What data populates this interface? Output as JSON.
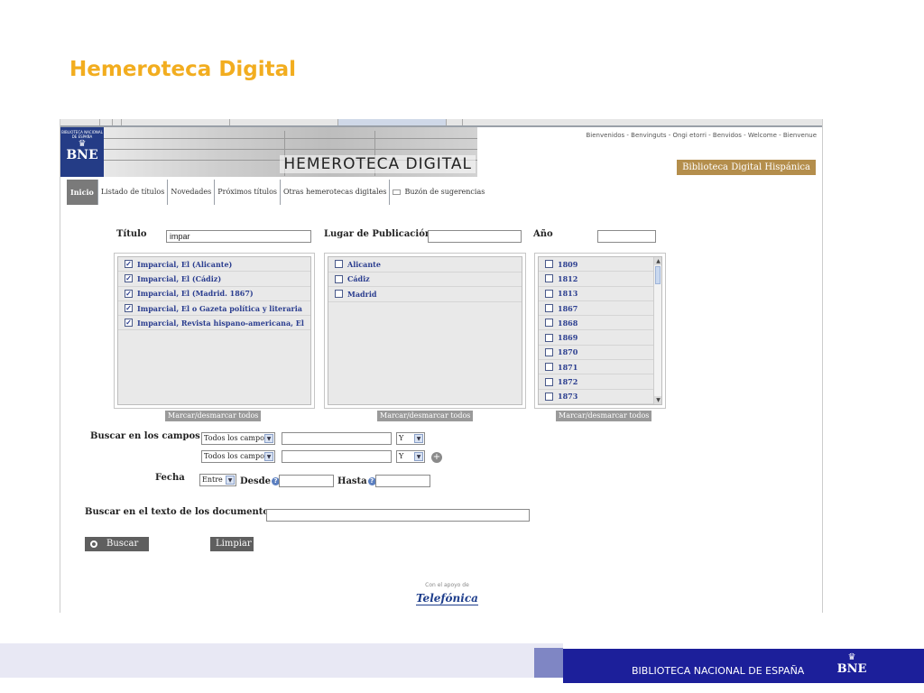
{
  "slide": {
    "title": "Hemeroteca Digital"
  },
  "header": {
    "logo_small": "BIBLIOTECA NACIONAL DE ESPAÑA",
    "logo_bne": "BNE",
    "banner_title": "HEMEROTECA DIGITAL",
    "welcome": "Bienvenidos - Benvinguts - Ongi etorri - Benvidos - Welcome - Bienvenue",
    "bdh_label": "Biblioteca Digital Hispánica"
  },
  "nav": {
    "items": [
      "Inicio",
      "Listado de títulos",
      "Novedades",
      "Próximos títulos",
      "Otras hemerotecas digitales",
      "Buzón de sugerencias"
    ]
  },
  "search": {
    "titulo_label": "Título",
    "titulo_value": "impar",
    "lugar_label": "Lugar de Publicación",
    "lugar_value": "",
    "ano_label": "Año",
    "ano_value": "",
    "titles": [
      "Imparcial, El (Alicante)",
      "Imparcial, El (Cádiz)",
      "Imparcial, El (Madrid. 1867)",
      "Imparcial, El o Gazeta política y literaria",
      "Imparcial, Revista hispano-americana, El"
    ],
    "places": [
      "Alicante",
      "Cádiz",
      "Madrid"
    ],
    "years": [
      "1809",
      "1812",
      "1813",
      "1867",
      "1868",
      "1869",
      "1870",
      "1871",
      "1872",
      "1873"
    ],
    "mark_all": "Marcar/desmarcar todos",
    "fields_label": "Buscar en los campos",
    "field_select_1": "Todos los campos",
    "field_select_2": "Todos los campos",
    "op_select_1": "Y",
    "op_select_2": "Y",
    "fecha_label": "Fecha",
    "fecha_select": "Entre",
    "desde_label": "Desde",
    "hasta_label": "Hasta",
    "fulltext_label": "Buscar en el texto de los documentos",
    "buscar_label": "Buscar",
    "limpiar_label": "Limpiar"
  },
  "sponsor": {
    "text": "Con el apoyo de",
    "name": "Telefónica"
  },
  "footer": {
    "text": "BIBLIOTECA NACIONAL DE ESPAÑA",
    "logo": "BNE"
  }
}
